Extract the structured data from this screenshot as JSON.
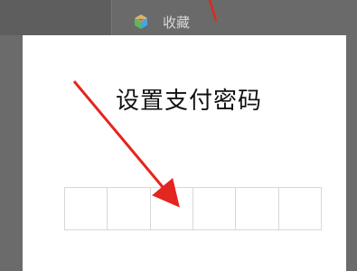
{
  "header": {
    "favorites_label": "收藏",
    "favorites_icon": "cube-icon"
  },
  "dialog": {
    "title": "设置支付密码",
    "pin_length": 6,
    "pin_values": [
      "",
      "",
      "",
      "",
      "",
      ""
    ]
  },
  "colors": {
    "arrow": "#e3261f",
    "dialog_background": "#ffffff",
    "box_border": "#d7d7d7"
  }
}
